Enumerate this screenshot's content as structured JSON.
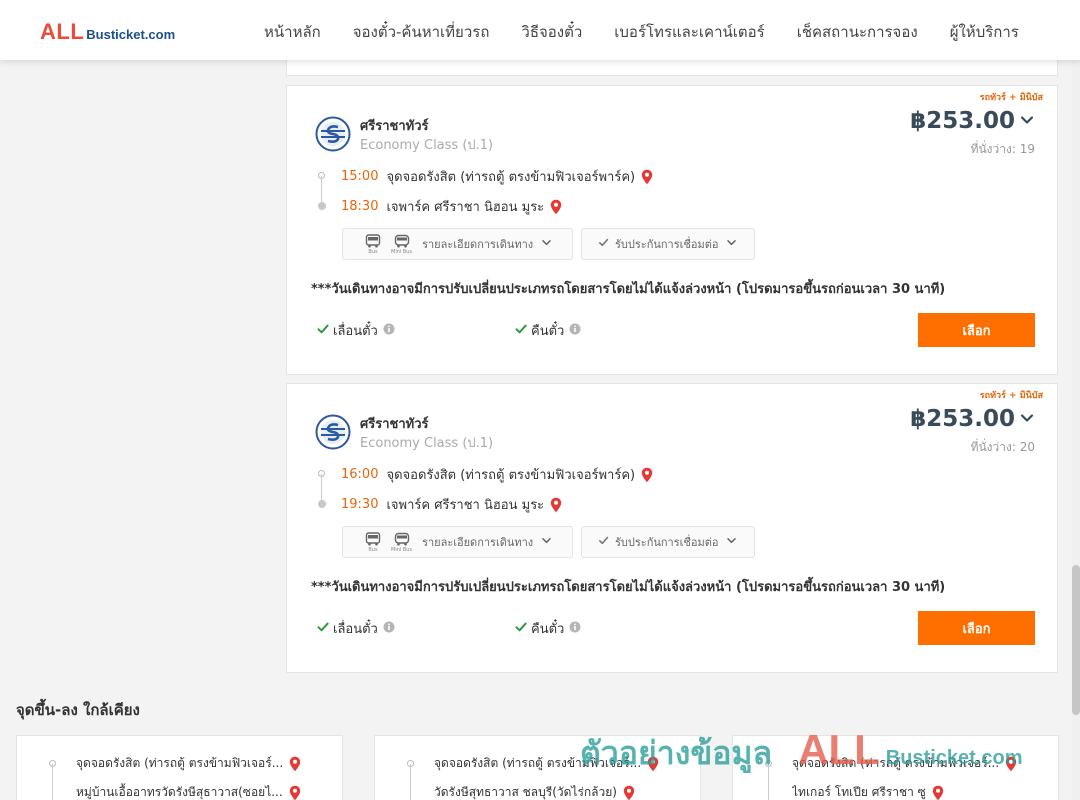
{
  "header": {
    "logo_primary": "ALL",
    "logo_secondary": "Busticket.com",
    "nav": [
      {
        "label": "หน้าหลัก"
      },
      {
        "label": "จองตั๋ว-ค้นหาเที่ยวรถ"
      },
      {
        "label": "วิธีจองตั๋ว"
      },
      {
        "label": "เบอร์โทรและเคาน์เตอร์"
      },
      {
        "label": "เช็คสถานะการจอง"
      },
      {
        "label": "ผู้ให้บริการ"
      }
    ]
  },
  "trips": [
    {
      "tag": "รถทัวร์ + มินิบัส",
      "operator": "ศรีราชาทัวร์",
      "class": "Economy Class (ป.1)",
      "price": "฿253.00",
      "seats": "ที่นั่งว่าง: 19",
      "depart_time": "15:00",
      "depart_place": "จุดจอดรังสิต (ท่ารถตู้ ตรงข้ามฟิวเจอร์พาร์ค)",
      "arrive_time": "18:30",
      "arrive_place": "เจพาร์ค ศรีราชา นิฮอน มูระ",
      "vehicle_bus": "Bus",
      "vehicle_minibus": "Mini Bus",
      "details_label": "รายละเอียดการเดินทาง",
      "connection_label": "รับประกันการเชื่อมต่อ",
      "notice": "***วันเดินทางอาจมีการปรับเปลี่ยนประเภทรถโดยสารโดยไม่ได้แจ้งล่วงหน้า (โปรดมารอขึ้นรถก่อนเวลา 30 นาที)",
      "postpone_label": "เลื่อนตั๋ว",
      "refund_label": "คืนตั๋ว",
      "select_label": "เลือก"
    },
    {
      "tag": "รถทัวร์ + มินิบัส",
      "operator": "ศรีราชาทัวร์",
      "class": "Economy Class (ป.1)",
      "price": "฿253.00",
      "seats": "ที่นั่งว่าง: 20",
      "depart_time": "16:00",
      "depart_place": "จุดจอดรังสิต (ท่ารถตู้ ตรงข้ามฟิวเจอร์พาร์ค)",
      "arrive_time": "19:30",
      "arrive_place": "เจพาร์ค ศรีราชา นิฮอน มูระ",
      "vehicle_bus": "Bus",
      "vehicle_minibus": "Mini Bus",
      "details_label": "รายละเอียดการเดินทาง",
      "connection_label": "รับประกันการเชื่อมต่อ",
      "notice": "***วันเดินทางอาจมีการปรับเปลี่ยนประเภทรถโดยสารโดยไม่ได้แจ้งล่วงหน้า (โปรดมารอขึ้นรถก่อนเวลา 30 นาที)",
      "postpone_label": "เลื่อนตั๋ว",
      "refund_label": "คืนตั๋ว",
      "select_label": "เลือก"
    }
  ],
  "nearby": {
    "title": "จุดขึ้น-ลง ใกล้เคียง",
    "cards": [
      {
        "from": "จุดจอดรังสิต (ท่ารถตู้ ตรงข้ามฟิวเจอร์...",
        "to": "หมู่บ้านเอื้ออาทรวัดรังษีสุธาวาส(ซอยไ..."
      },
      {
        "from": "จุดจอดรังสิต (ท่ารถตู้ ตรงข้ามฟิวเจอร์...",
        "to": "วัดรังษีสุทธาวาส ชลบุรี(วัดไร่กล้วย)"
      },
      {
        "from": "จุดจอดรังสิต (ท่ารถตู้ ตรงข้ามฟิวเจอร์...",
        "to": "ไทเกอร์ โทเปีย ศรีราชา ซู"
      }
    ]
  },
  "watermark": {
    "thai": "ตัวอย่างข้อมูล",
    "brand": "ALL",
    "brand_rest": "Busticket.com"
  },
  "colors": {
    "accent_orange": "#ff6f00",
    "time_orange": "#e8650a",
    "pin_red": "#e53935",
    "check_green": "#2e9b3a",
    "price_slate": "#394a59"
  },
  "icons": [
    "operator-logo-icon",
    "chevron-down-icon",
    "map-pin-icon",
    "bus-icon",
    "minibus-icon",
    "check-icon",
    "info-icon"
  ]
}
